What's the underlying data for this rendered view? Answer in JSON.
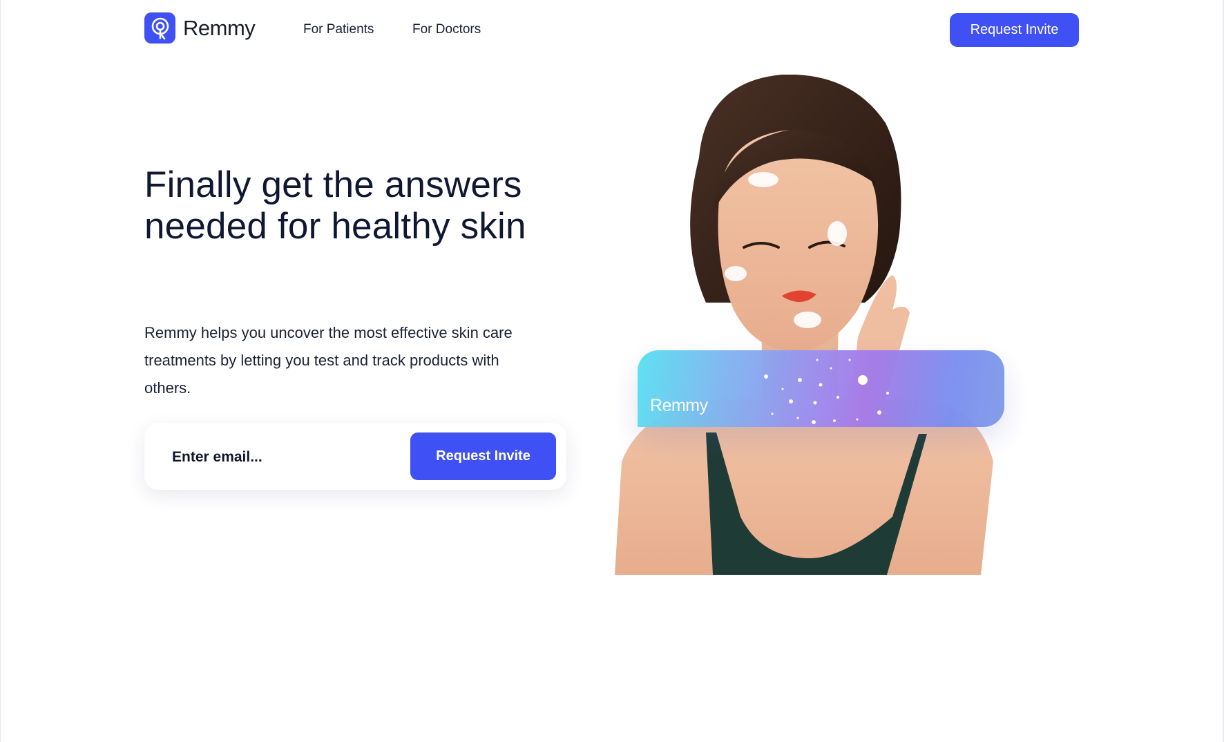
{
  "header": {
    "brand": "Remmy",
    "nav": [
      {
        "label": "For Patients"
      },
      {
        "label": "For Doctors"
      }
    ],
    "cta_label": "Request Invite"
  },
  "hero": {
    "title_line1": "Finally get the answers",
    "title_line2": "needed for healthy skin",
    "subtitle": "Remmy helps you uncover the most effective skin care treatments by letting you test and track products with others.",
    "email_placeholder": "Enter email...",
    "submit_label": "Request Invite",
    "card_brand": "Remmy"
  },
  "colors": {
    "primary": "#3f51f5",
    "text_dark": "#0f1733",
    "background": "#ffffff"
  },
  "icons": {
    "logo": "remmy-logo-icon"
  }
}
